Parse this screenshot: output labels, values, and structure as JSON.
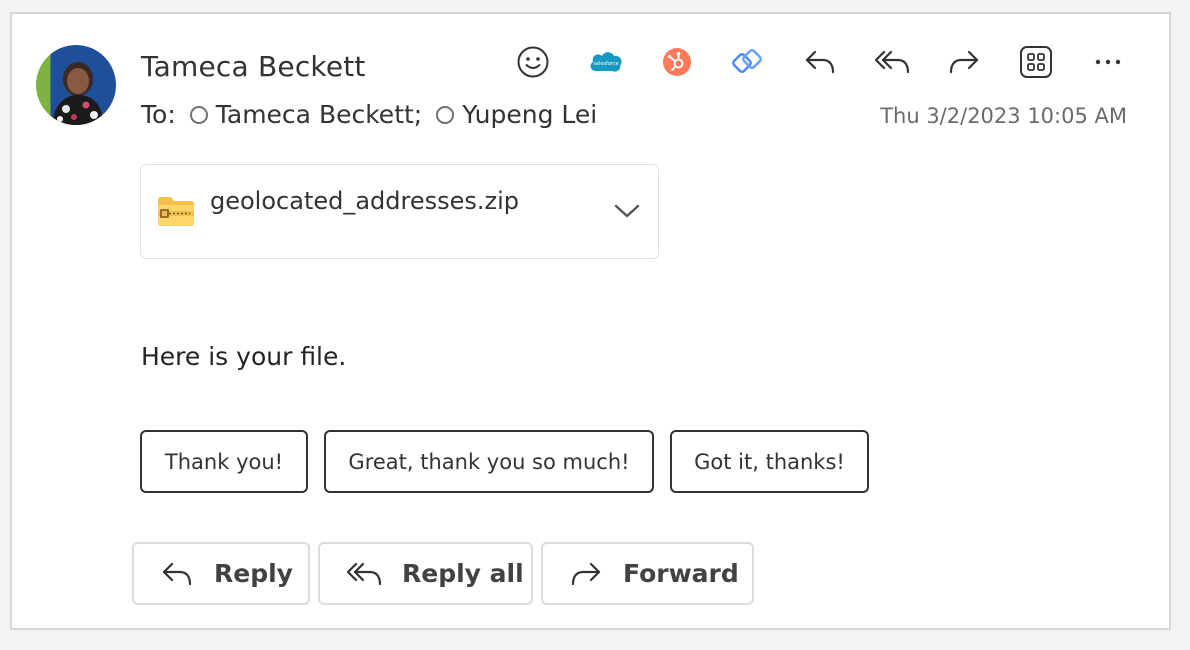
{
  "message": {
    "sender": "Tameca Beckett",
    "to_label": "To:",
    "recipients": [
      "Tameca Beckett;",
      "Yupeng Lei"
    ],
    "date": "Thu 3/2/2023 10:05 AM",
    "body": "Here is your file."
  },
  "toolbar": {
    "icons": [
      "smiley-icon",
      "salesforce-icon",
      "hubspot-icon",
      "viva-insights-icon",
      "reply-icon",
      "reply-all-icon",
      "forward-icon",
      "apps-icon",
      "more-icon"
    ],
    "salesforce_text": "salesforce"
  },
  "attachment": {
    "filename": "geolocated_addresses.zip",
    "icon": "zip-folder-icon"
  },
  "suggested_replies": [
    "Thank you!",
    "Great, thank you so much!",
    "Got it, thanks!"
  ],
  "actions": {
    "reply": "Reply",
    "reply_all": "Reply all",
    "forward": "Forward"
  },
  "colors": {
    "salesforce": "#1798c1",
    "hubspot": "#ff7a59",
    "viva": "#4f8df5"
  }
}
